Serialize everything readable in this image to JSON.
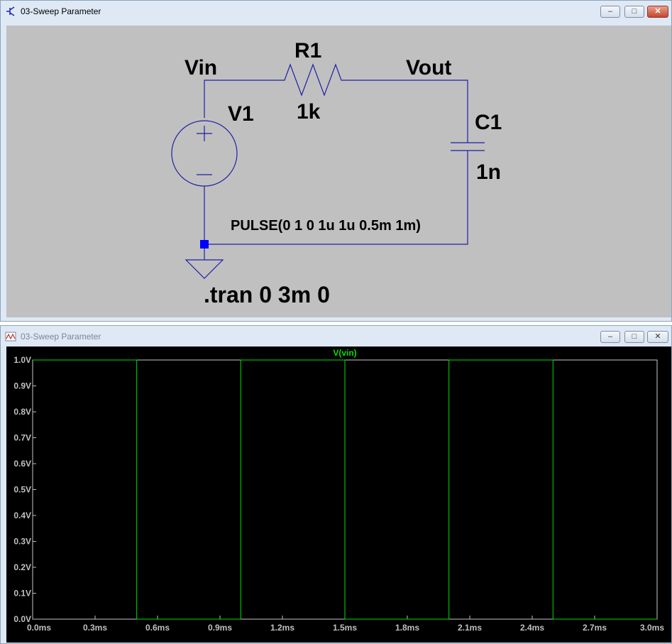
{
  "schematic_window": {
    "title": "03-Sweep Parameter",
    "buttons": {
      "minimize": "–",
      "maximize": "□",
      "close": "✕"
    },
    "labels": {
      "vin": "Vin",
      "vout": "Vout",
      "r1_name": "R1",
      "r1_value": "1k",
      "v1_name": "V1",
      "c1_name": "C1",
      "c1_value": "1n",
      "pulse": "PULSE(0 1 0 1u 1u 0.5m 1m)",
      "tran": ".tran 0 3m 0"
    },
    "colors": {
      "background": "#c0c0c0",
      "wire": "#1f1fa8",
      "text": "#000000"
    }
  },
  "waveform_window": {
    "title": "03-Sweep Parameter",
    "buttons": {
      "minimize": "–",
      "maximize": "□",
      "close": "✕"
    },
    "colors": {
      "background": "#000000",
      "trace": "#00e000",
      "axis_text": "#c0c0c0"
    }
  },
  "chart_data": {
    "type": "line",
    "title": "",
    "xlabel": "",
    "ylabel": "",
    "xlim": [
      0,
      3.0
    ],
    "ylim": [
      0,
      1.0
    ],
    "x_ticks": [
      "0.0ms",
      "0.3ms",
      "0.6ms",
      "0.9ms",
      "1.2ms",
      "1.5ms",
      "1.8ms",
      "2.1ms",
      "2.4ms",
      "2.7ms",
      "3.0ms"
    ],
    "y_ticks": [
      "0.0V",
      "0.1V",
      "0.2V",
      "0.3V",
      "0.4V",
      "0.5V",
      "0.6V",
      "0.7V",
      "0.8V",
      "0.9V",
      "1.0V"
    ],
    "series": [
      {
        "name": "V(vin)",
        "color": "#00e000",
        "x": [
          0,
          0.5,
          0.5,
          1.0,
          1.0,
          1.5,
          1.5,
          2.0,
          2.0,
          2.5,
          2.5,
          3.0
        ],
        "y": [
          1,
          1,
          0,
          0,
          1,
          1,
          0,
          0,
          1,
          1,
          0,
          0
        ]
      }
    ]
  }
}
